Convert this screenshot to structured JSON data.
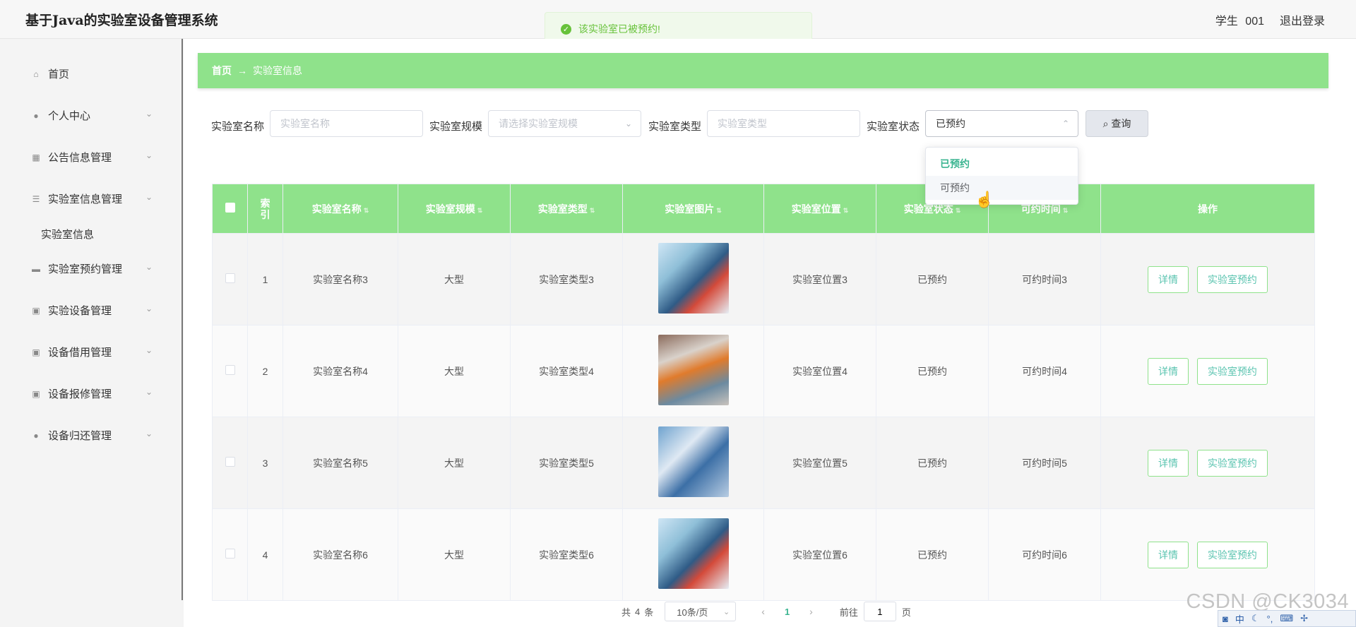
{
  "header": {
    "title": "基于Java的实验室设备管理系统",
    "user_role": "学生",
    "user_id": "001",
    "logout": "退出登录"
  },
  "toast": {
    "message": "该实验室已被预约!"
  },
  "sidebar": {
    "items": [
      {
        "label": "首页",
        "icon": "home-icon"
      },
      {
        "label": "个人中心",
        "icon": "user-icon"
      },
      {
        "label": "公告信息管理",
        "icon": "grid-icon"
      },
      {
        "label": "实验室信息管理",
        "icon": "list-icon"
      },
      {
        "label": "实验室信息",
        "icon": ""
      },
      {
        "label": "实验室预约管理",
        "icon": "ticket-icon"
      },
      {
        "label": "实验设备管理",
        "icon": "clipboard-icon"
      },
      {
        "label": "设备借用管理",
        "icon": "clipboard-icon"
      },
      {
        "label": "设备报修管理",
        "icon": "clipboard-icon"
      },
      {
        "label": "设备归还管理",
        "icon": "user-icon"
      }
    ]
  },
  "breadcrumb": {
    "home": "首页",
    "current": "实验室信息"
  },
  "search": {
    "name_label": "实验室名称",
    "name_placeholder": "实验室名称",
    "scale_label": "实验室规模",
    "scale_placeholder": "请选择实验室规模",
    "type_label": "实验室类型",
    "type_placeholder": "实验室类型",
    "status_label": "实验室状态",
    "status_value": "已预约",
    "button": "查询"
  },
  "status_dropdown": {
    "options": [
      "已预约",
      "可预约"
    ]
  },
  "table": {
    "columns": [
      "索引",
      "实验室名称",
      "实验室规模",
      "实验室类型",
      "实验室图片",
      "实验室位置",
      "实验室状态",
      "可约时间",
      "操作"
    ],
    "rows": [
      {
        "index": "1",
        "name": "实验室名称3",
        "scale": "大型",
        "type": "实验室类型3",
        "location": "实验室位置3",
        "status": "已预约",
        "time": "可约时间3"
      },
      {
        "index": "2",
        "name": "实验室名称4",
        "scale": "大型",
        "type": "实验室类型4",
        "location": "实验室位置4",
        "status": "已预约",
        "time": "可约时间4"
      },
      {
        "index": "3",
        "name": "实验室名称5",
        "scale": "大型",
        "type": "实验室类型5",
        "location": "实验室位置5",
        "status": "已预约",
        "time": "可约时间5"
      },
      {
        "index": "4",
        "name": "实验室名称6",
        "scale": "大型",
        "type": "实验室类型6",
        "location": "实验室位置6",
        "status": "已预约",
        "time": "可约时间6"
      }
    ],
    "actions": {
      "detail": "详情",
      "reserve": "实验室预约"
    }
  },
  "pagination": {
    "total_prefix": "共",
    "total": "4",
    "total_suffix": "条",
    "page_size": "10条/页",
    "current_page": "1",
    "goto_label": "前往",
    "goto_value": "1",
    "page_suffix": "页"
  },
  "watermark": "CSDN @CK3034",
  "ime": {
    "mode": "中"
  },
  "colors": {
    "accent": "#8fe28b",
    "link": "#3bb591",
    "toast_bg": "#f0f9eb",
    "toast_text": "#67c23a"
  }
}
